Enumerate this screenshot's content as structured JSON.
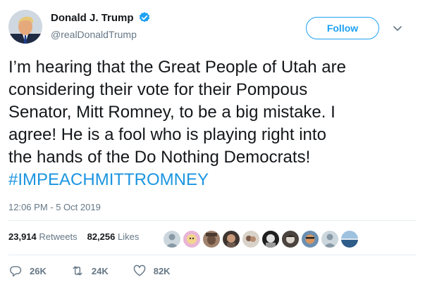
{
  "author": {
    "display_name": "Donald J. Trump",
    "handle": "@realDonaldTrump",
    "verified": true
  },
  "header": {
    "follow_label": "Follow"
  },
  "tweet": {
    "lines": [
      "I’m hearing that the Great People of Utah are",
      "considering their vote for their Pompous",
      "Senator, Mitt Romney, to be a big mistake. I",
      "agree! He is a fool who is playing right into",
      "the hands of the Do Nothing Democrats!"
    ],
    "hashtag": "#IMPEACHMITTROMNEY",
    "timestamp": "12:06 PM - 5 Oct 2019"
  },
  "stats": {
    "retweets_count": "23,914",
    "retweets_label": "Retweets",
    "likes_count": "82,256",
    "likes_label": "Likes"
  },
  "liker_avatars": [
    {
      "name": "default",
      "color": "#9aa7b3"
    },
    {
      "name": "cartoon",
      "color": "#f2d089"
    },
    {
      "name": "photo",
      "color": "#8b6f5b"
    },
    {
      "name": "photo",
      "color": "#5a4a40"
    },
    {
      "name": "photo",
      "color": "#b0a49a"
    },
    {
      "name": "photo",
      "color": "#2d2d2d"
    },
    {
      "name": "photo",
      "color": "#3f3a36"
    },
    {
      "name": "photo",
      "color": "#c27a4b"
    },
    {
      "name": "default",
      "color": "#9aa7b3"
    },
    {
      "name": "landscape",
      "color": "#3e6a9a"
    }
  ],
  "actions": {
    "replies": "26K",
    "retweets": "24K",
    "likes": "82K"
  },
  "colors": {
    "accent": "#1da1f2",
    "hashtag": "#1b95e0",
    "muted": "#657786",
    "divider": "#e6ecf0"
  }
}
